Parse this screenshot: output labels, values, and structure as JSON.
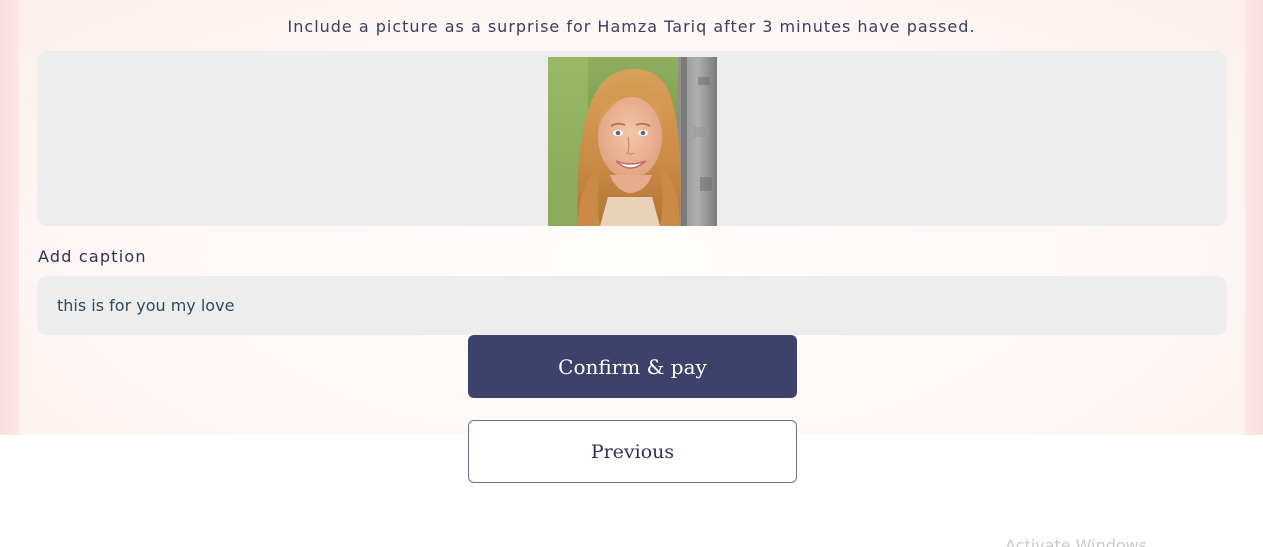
{
  "instruction": "Include a picture as a surprise for Hamza Tariq after 3 minutes have passed.",
  "upload": {
    "image_alt": "uploaded photo"
  },
  "caption": {
    "label": "Add caption",
    "value": "this is for you my love"
  },
  "buttons": {
    "confirm_label": "Confirm & pay",
    "previous_label": "Previous"
  },
  "system": {
    "watermark": "Activate Windows"
  },
  "colors": {
    "primary": "#3e426b",
    "field_bg": "#ededed",
    "text_dark": "#2f3350",
    "input_text": "#2d4a5e"
  }
}
